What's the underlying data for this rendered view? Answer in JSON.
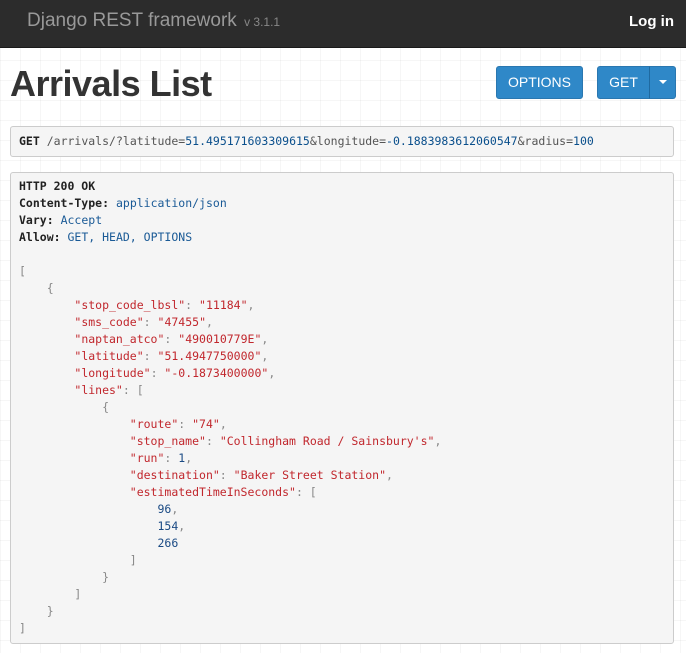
{
  "navbar": {
    "brand": "Django REST framework",
    "version": "v 3.1.1",
    "login_label": "Log in"
  },
  "page": {
    "title": "Arrivals List"
  },
  "buttons": {
    "options": "OPTIONS",
    "get": "GET"
  },
  "request": {
    "method": "GET",
    "path": "/arrivals/",
    "params": [
      {
        "key": "latitude",
        "value": "51.495171603309615"
      },
      {
        "key": "longitude",
        "value": "-0.1883983612060547"
      },
      {
        "key": "radius",
        "value": "100"
      }
    ]
  },
  "response": {
    "status": "HTTP 200 OK",
    "headers": [
      {
        "name": "Content-Type",
        "value": "application/json"
      },
      {
        "name": "Vary",
        "value": "Accept"
      },
      {
        "name": "Allow",
        "value": "GET, HEAD, OPTIONS"
      }
    ],
    "body": [
      {
        "stop_code_lbsl": "11184",
        "sms_code": "47455",
        "naptan_atco": "490010779E",
        "latitude": "51.4947750000",
        "longitude": "-0.1873400000",
        "lines": [
          {
            "route": "74",
            "stop_name": "Collingham Road / Sainsbury's",
            "run": 1,
            "destination": "Baker Street Station",
            "estimatedTimeInSeconds": [
              96,
              154,
              266
            ]
          }
        ]
      }
    ]
  },
  "colors": {
    "navbar_bg": "#2c2c2c",
    "button_primary": "#2f88c8",
    "json_key": "#c1272d",
    "json_string": "#c1272d",
    "json_number": "#1a4a84"
  }
}
